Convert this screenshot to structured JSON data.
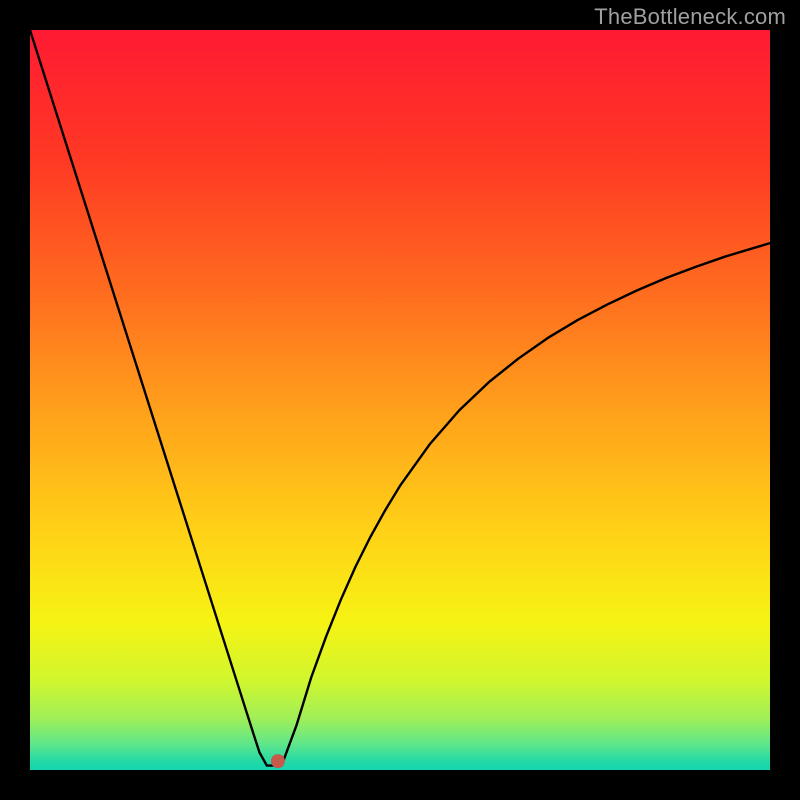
{
  "watermark": "TheBottleneck.com",
  "chart_data": {
    "type": "line",
    "title": "",
    "xlabel": "",
    "ylabel": "",
    "xlim": [
      0,
      100
    ],
    "ylim": [
      0,
      100
    ],
    "grid": false,
    "legend": false,
    "x": [
      0,
      2,
      4,
      6,
      8,
      10,
      12,
      14,
      16,
      18,
      20,
      22,
      24,
      26,
      28,
      30,
      31,
      32,
      33,
      34,
      36,
      38,
      40,
      42,
      44,
      46,
      48,
      50,
      54,
      58,
      62,
      66,
      70,
      74,
      78,
      82,
      86,
      90,
      94,
      98,
      100
    ],
    "values": [
      100,
      93.7,
      87.4,
      81.1,
      74.8,
      68.5,
      62.2,
      55.9,
      49.6,
      43.3,
      37.0,
      30.7,
      24.4,
      18.1,
      11.8,
      5.5,
      2.4,
      0.6,
      0.6,
      0.6,
      6.0,
      12.5,
      18.0,
      23.0,
      27.5,
      31.5,
      35.1,
      38.4,
      44.0,
      48.6,
      52.4,
      55.6,
      58.4,
      60.8,
      62.9,
      64.8,
      66.5,
      68.0,
      69.4,
      70.6,
      71.2
    ],
    "marker": {
      "x": 33.5,
      "y": 1.2
    },
    "background_gradient": {
      "type": "vertical",
      "stops": [
        {
          "pos": 0.0,
          "color": "#ff1a33"
        },
        {
          "pos": 0.18,
          "color": "#ff3a24"
        },
        {
          "pos": 0.35,
          "color": "#ff6b1f"
        },
        {
          "pos": 0.52,
          "color": "#ffa21b"
        },
        {
          "pos": 0.68,
          "color": "#ffd217"
        },
        {
          "pos": 0.8,
          "color": "#f6f313"
        },
        {
          "pos": 0.88,
          "color": "#d0f62e"
        },
        {
          "pos": 0.93,
          "color": "#a0ef58"
        },
        {
          "pos": 0.965,
          "color": "#5fe68b"
        },
        {
          "pos": 0.99,
          "color": "#1fd9a9"
        },
        {
          "pos": 1.0,
          "color": "#14d4b0"
        }
      ]
    },
    "line_style": {
      "stroke": "#000000",
      "stroke_width": 2.4
    },
    "marker_style": {
      "fill": "#c85a4c",
      "radius": 7
    }
  }
}
